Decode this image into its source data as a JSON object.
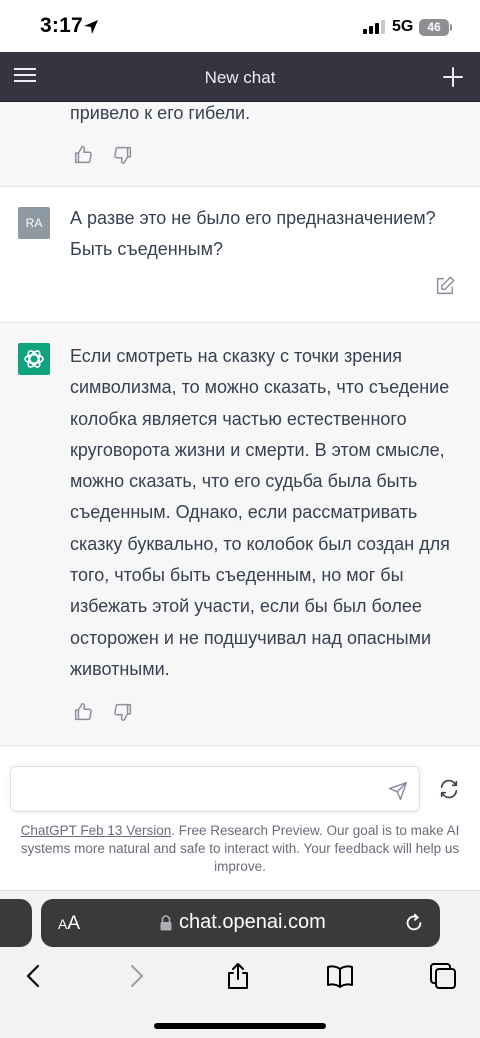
{
  "status_bar": {
    "time": "3:17",
    "network": "5G",
    "battery": "46"
  },
  "header": {
    "title": "New chat"
  },
  "messages": [
    {
      "role": "assistant",
      "text": "привело к его гибели."
    },
    {
      "role": "user",
      "avatar": "RA",
      "text": "А разве это не было его предназначением? Быть съеденным?"
    },
    {
      "role": "assistant",
      "text": "Если смотреть на сказку с точки зрения символизма, то можно сказать, что съедение колобка является частью естественного круговорота жизни и смерти. В этом смысле, можно сказать, что его судьба была быть съеденным. Однако, если рассматривать сказку буквально, то колобок был создан для того, чтобы быть съеденным, но мог бы избежать этой участи, если бы был более осторожен и не подшучивал над опасными животными."
    }
  ],
  "composer": {
    "value": ""
  },
  "footer": {
    "link": "ChatGPT Feb 13 Version",
    "text": ". Free Research Preview. Our goal is to make AI systems more natural and safe to interact with. Your feedback will help us improve."
  },
  "browser": {
    "aa_label_small": "A",
    "aa_label_big": "A",
    "url": "chat.openai.com"
  },
  "icons": {
    "menu": "hamburger-icon",
    "new_chat": "plus-icon",
    "like": "thumbs-up-icon",
    "dislike": "thumbs-down-icon",
    "edit": "edit-icon",
    "send": "send-icon",
    "regenerate": "refresh-icon",
    "lock": "lock-icon",
    "reload": "reload-icon"
  },
  "colors": {
    "header_bg": "#343541",
    "assistant_bg": "#f7f7f8",
    "bot_avatar": "#10a37f",
    "user_avatar": "#8e9aa3"
  }
}
